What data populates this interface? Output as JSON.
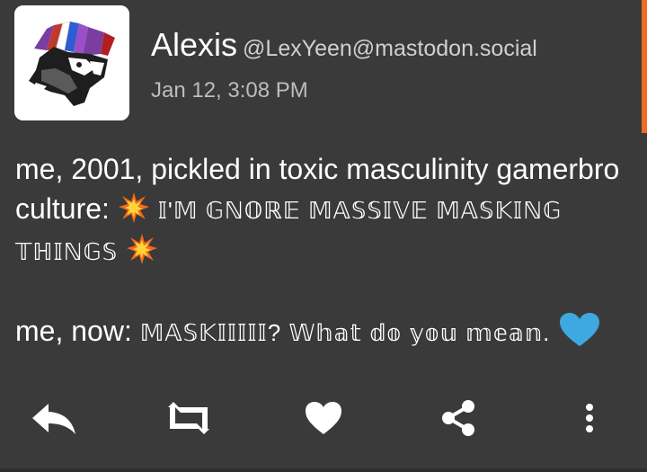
{
  "status": {
    "author_display_name": "Alexis",
    "author_handle": "@LexYeen@mastodon.social",
    "timestamp": "Jan 12, 3:08 PM",
    "avatar_icon": "wolf-mohawk-avatar",
    "content": {
      "line1_text": "me, 2001, pickled in toxic masculinity gamerbro culture:",
      "line1_emoji_start": "collision-emoji",
      "line1_styled_text": "𝕀'𝕄 𝔾ℕ𝕆ℝ𝔼 𝕄𝔸𝕊𝕊𝕀𝕍𝔼 𝕄𝔸𝕊𝕂𝕀ℕ𝔾 𝕋ℍ𝕀ℕ𝔾𝕊",
      "line1_emoji_end": "collision-emoji",
      "line2_text": "me, now:",
      "line2_styled_text": "𝕄𝔸𝕊𝕂𝕀𝕀𝕀𝕀𝕀? 𝕎𝕙𝕒𝕥 𝕕𝕠 𝕪𝕠𝕦 𝕞𝕖𝕒𝕟.",
      "line2_emoji": "blue-heart-emoji"
    }
  },
  "actions": [
    {
      "name": "reply-icon"
    },
    {
      "name": "boost-icon"
    },
    {
      "name": "favourite-icon"
    },
    {
      "name": "share-icon"
    },
    {
      "name": "more-options-icon"
    }
  ],
  "colors": {
    "background": "#3a3a3a",
    "accent_scroll": "#f06a26",
    "text_primary": "#ffffff",
    "text_secondary": "#bdbdbd",
    "heart_blue": "#3ea8e0",
    "burst_orange": "#f26a1b",
    "burst_yellow": "#ffd43b"
  }
}
